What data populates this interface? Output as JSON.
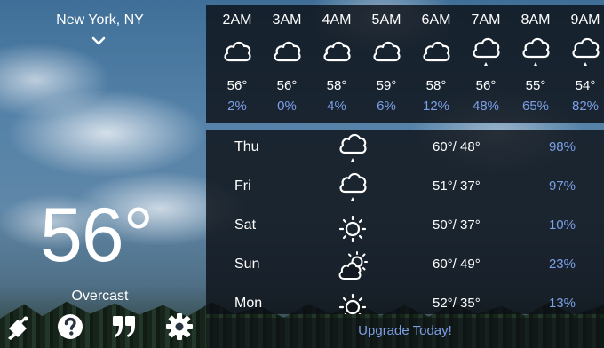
{
  "location": {
    "name": "New York, NY"
  },
  "current": {
    "temp": "56°",
    "condition": "Overcast"
  },
  "hourly": [
    {
      "time": "2AM",
      "icon": "cloud-icon",
      "temp": "56°",
      "precip": "2%"
    },
    {
      "time": "3AM",
      "icon": "cloud-icon",
      "temp": "56°",
      "precip": "0%"
    },
    {
      "time": "4AM",
      "icon": "cloud-icon",
      "temp": "58°",
      "precip": "4%"
    },
    {
      "time": "5AM",
      "icon": "cloud-icon",
      "temp": "59°",
      "precip": "6%"
    },
    {
      "time": "6AM",
      "icon": "cloud-icon",
      "temp": "58°",
      "precip": "12%"
    },
    {
      "time": "7AM",
      "icon": "drizzle-icon",
      "temp": "56°",
      "precip": "48%"
    },
    {
      "time": "8AM",
      "icon": "drizzle-icon",
      "temp": "55°",
      "precip": "65%"
    },
    {
      "time": "9AM",
      "icon": "drizzle-icon",
      "temp": "54°",
      "precip": "82%"
    }
  ],
  "daily": [
    {
      "day": "Thu",
      "icon": "drizzle-icon",
      "hilo": "60°/ 48°",
      "precip": "98%"
    },
    {
      "day": "Fri",
      "icon": "drizzle-icon",
      "hilo": "51°/ 37°",
      "precip": "97%"
    },
    {
      "day": "Sat",
      "icon": "sun-icon",
      "hilo": "50°/ 37°",
      "precip": "10%"
    },
    {
      "day": "Sun",
      "icon": "partly-cloudy-icon",
      "hilo": "60°/ 49°",
      "precip": "23%"
    },
    {
      "day": "Mon",
      "icon": "sun-icon",
      "hilo": "52°/ 35°",
      "precip": "13%"
    }
  ],
  "upgrade": {
    "label": "Upgrade Today!"
  },
  "toolbar": [
    "satellite-dish-icon",
    "help-icon",
    "quote-icon",
    "gear-icon"
  ],
  "colors": {
    "accent": "#7c9fe6",
    "panel": "#0c1016"
  }
}
